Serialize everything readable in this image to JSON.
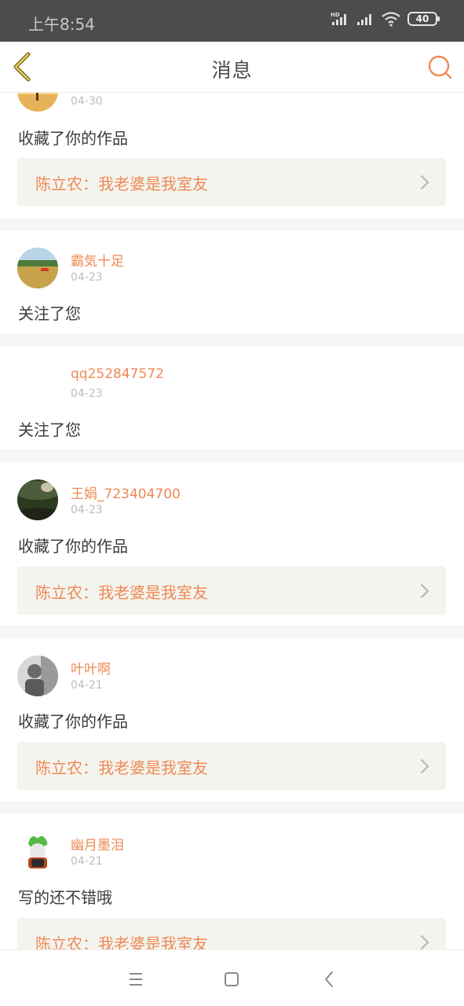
{
  "status_bar": {
    "time": "上午8:54",
    "signal_label": "HD",
    "battery": "40"
  },
  "nav": {
    "title": "消息",
    "back_icon": "back-chevron-icon",
    "search_icon": "search-icon"
  },
  "accent_color": "#ee8a55",
  "messages": [
    {
      "user": "",
      "date": "04-30",
      "action": "收藏了你的作品",
      "work": "陈立农：我老婆是我室友"
    },
    {
      "user": "霸気十足",
      "date": "04-23",
      "action": "关注了您",
      "work": ""
    },
    {
      "user": "qq252847572",
      "date": "04-23",
      "action": "关注了您",
      "work": ""
    },
    {
      "user": "王娟_723404700",
      "date": "04-23",
      "action": "收藏了你的作品",
      "work": "陈立农：我老婆是我室友"
    },
    {
      "user": "叶叶啊",
      "date": "04-21",
      "action": "收藏了你的作品",
      "work": "陈立农：我老婆是我室友"
    },
    {
      "user": "幽月墨泪",
      "date": "04-21",
      "action": "写的还不错哦",
      "work": "陈立农：我老婆是我室友"
    }
  ]
}
